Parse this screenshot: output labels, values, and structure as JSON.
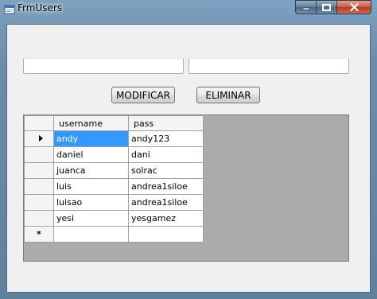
{
  "window": {
    "title": "FrmUsers",
    "minimize_glyph": "—",
    "maximize_glyph": "☐",
    "close_glyph": "✕"
  },
  "form": {
    "username_input": {
      "value": "",
      "placeholder": ""
    },
    "password_input": {
      "value": "",
      "placeholder": ""
    },
    "modify_button": "MODIFICAR",
    "delete_button": "ELIMINAR"
  },
  "grid": {
    "columns": [
      "username",
      "pass"
    ],
    "rows": [
      {
        "username": "andy",
        "pass": "andy123"
      },
      {
        "username": "daniel",
        "pass": "dani"
      },
      {
        "username": "juanca",
        "pass": "solrac"
      },
      {
        "username": "luis",
        "pass": "andrea1siloe"
      },
      {
        "username": "luisao",
        "pass": "andrea1siloe"
      },
      {
        "username": "yesi",
        "pass": "yesgamez"
      }
    ],
    "new_row_marker": "*",
    "current_row_icon": "triangle-right-icon"
  },
  "colors": {
    "selection": "#3399ff",
    "grid_background": "#ababab",
    "form_background": "#f0f0f0"
  }
}
